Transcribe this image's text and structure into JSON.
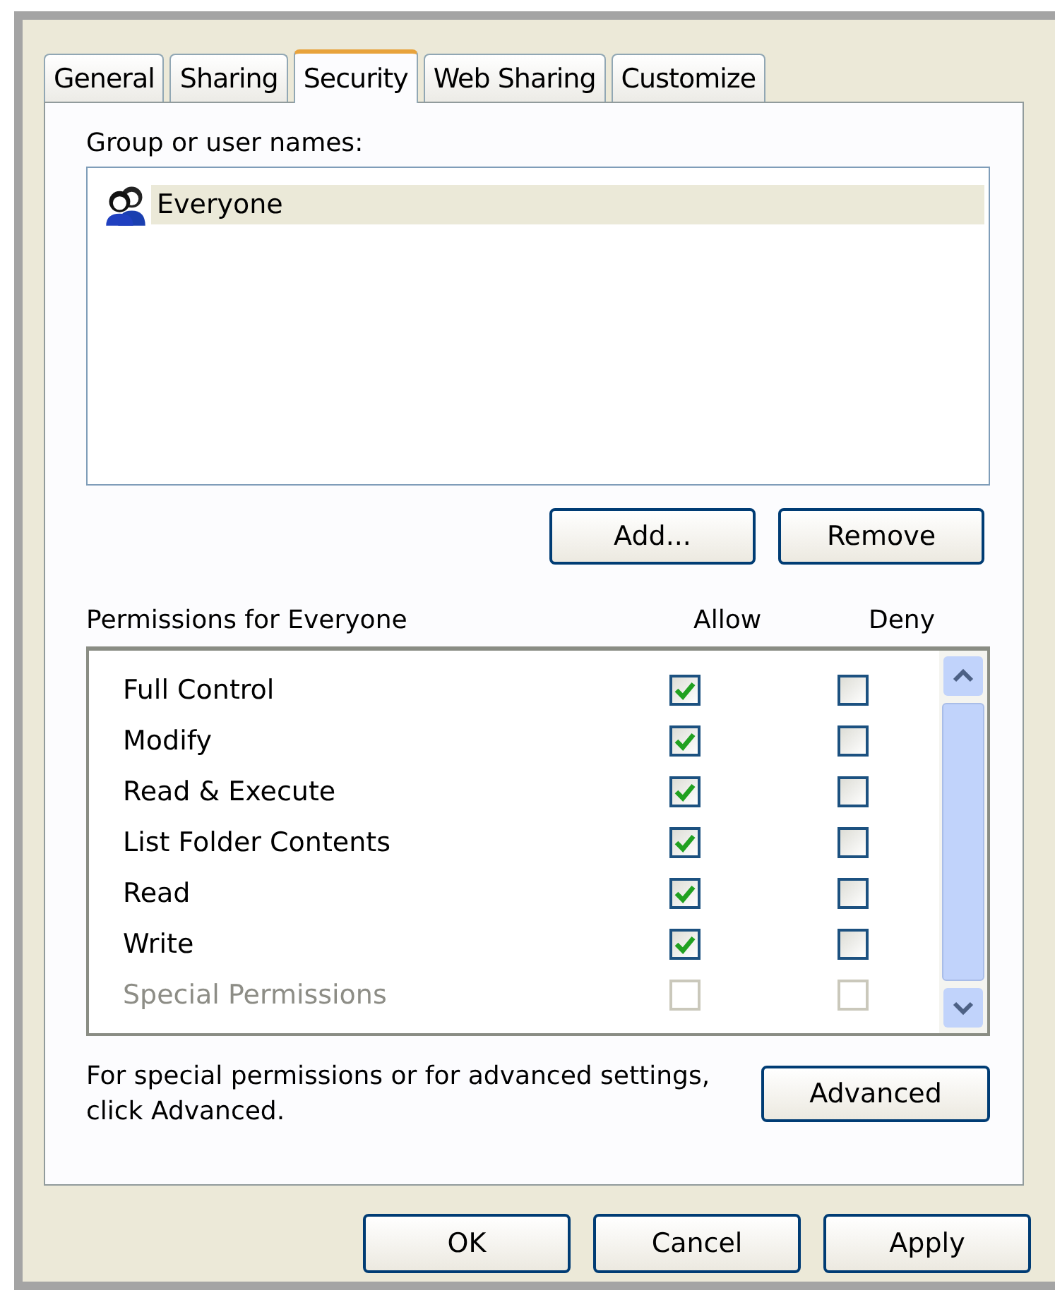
{
  "tabs": [
    {
      "label": "General",
      "selected": false
    },
    {
      "label": "Sharing",
      "selected": false
    },
    {
      "label": "Security",
      "selected": true
    },
    {
      "label": "Web Sharing",
      "selected": false
    },
    {
      "label": "Customize",
      "selected": false
    }
  ],
  "group_label": "Group or user names:",
  "users": [
    {
      "name": "Everyone",
      "selected": true
    }
  ],
  "user_buttons": [
    "Add...",
    "Remove"
  ],
  "permissions_label": "Permissions for Everyone",
  "columns": [
    "Allow",
    "Deny"
  ],
  "permissions": [
    {
      "name": "Full Control",
      "allow": true,
      "deny": false,
      "disabled": false
    },
    {
      "name": "Modify",
      "allow": true,
      "deny": false,
      "disabled": false
    },
    {
      "name": "Read & Execute",
      "allow": true,
      "deny": false,
      "disabled": false
    },
    {
      "name": "List Folder Contents",
      "allow": true,
      "deny": false,
      "disabled": false
    },
    {
      "name": "Read",
      "allow": true,
      "deny": false,
      "disabled": false
    },
    {
      "name": "Write",
      "allow": true,
      "deny": false,
      "disabled": false
    },
    {
      "name": "Special Permissions",
      "allow": false,
      "deny": false,
      "disabled": true
    }
  ],
  "advanced_text": "For special permissions or for advanced settings, click Advanced.",
  "advanced_button": "Advanced",
  "buttons": [
    "OK",
    "Cancel",
    "Apply"
  ]
}
